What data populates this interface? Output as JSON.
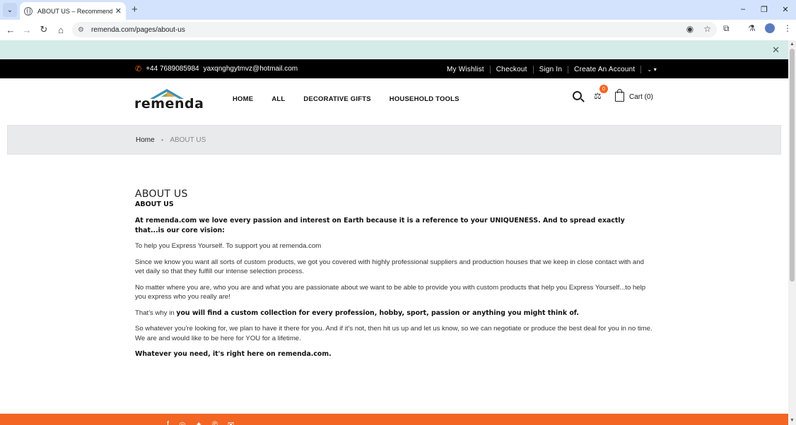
{
  "browser": {
    "tab_title": "ABOUT US – Recommendation",
    "tab_close": "✕",
    "new_tab": "+",
    "url": "remenda.com/pages/about-us",
    "window_controls": [
      "–",
      "❐",
      "✕"
    ]
  },
  "promo": {
    "close": "✕"
  },
  "topbar": {
    "phone": "+44 7689085984",
    "email": "yaxqnghgytmvz@hotmail.com",
    "links": [
      "My Wishlist",
      "Checkout",
      "Sign In",
      "Create An Account"
    ]
  },
  "header": {
    "logo_text": "remenda",
    "nav": [
      "HOME",
      "ALL",
      "DECORATIVE GIFTS",
      "HOUSEHOLD TOOLS"
    ],
    "compare_count": "0",
    "cart_label": "Cart (0)"
  },
  "breadcrumb": {
    "home": "Home",
    "current": "ABOUT US"
  },
  "content": {
    "title": "ABOUT US",
    "subtitle": "ABOUT US",
    "intro": "At remenda.com  we love every passion and interest on Earth because it is a reference to your UNIQUENESS. And to spread exactly that...is our core vision:",
    "p1": "To help you Express Yourself. To support you at remenda.com",
    "p2": "Since we know you want all sorts of custom products, we got you covered with highly professional suppliers and production houses that we keep in close contact with and vet daily so that they fulfill our intense selection process.",
    "p3": "No matter where you are, who you are and what you are passionate about we want to be able to provide you with custom products that help you Express Yourself...to help you express who you really are!",
    "p4_lead": "That's why in ",
    "p4_strong": " you will find a custom collection for every profession, hobby, sport, passion or anything you might think of.",
    "p5": "So whatever you're looking for, we plan to have it there for you. And if it's not, then hit us up and let us know, so we can negotiate or produce the best deal for you in no time. We are and would like to be here for YOU for a lifetime.",
    "closing": "Whatever you need, it's right here on remenda.com."
  },
  "colors": {
    "accent": "#f26522",
    "promo_bg": "#d5ebe8",
    "topbar_bg": "#000000",
    "breadcrumb_bg": "#e9eaec"
  }
}
